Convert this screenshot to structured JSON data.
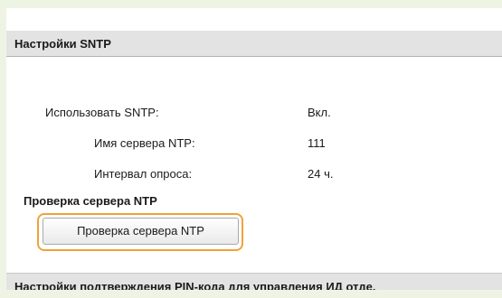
{
  "section_top": {
    "title": "Настройки SNTP"
  },
  "settings": {
    "use_sntp": {
      "label": "Использовать SNTP:",
      "value": "Вкл."
    },
    "ntp_server_name": {
      "label": "Имя сервера NTP:",
      "value": "111"
    },
    "poll_interval": {
      "label": "Интервал опроса:",
      "value": "24 ч."
    }
  },
  "check": {
    "heading": "Проверка сервера NTP",
    "button_label": "Проверка сервера NTP",
    "highlight_color": "#f0a23a"
  },
  "section_bottom": {
    "title": "Настройки подтверждения PIN-кода для управления ИД отде."
  }
}
